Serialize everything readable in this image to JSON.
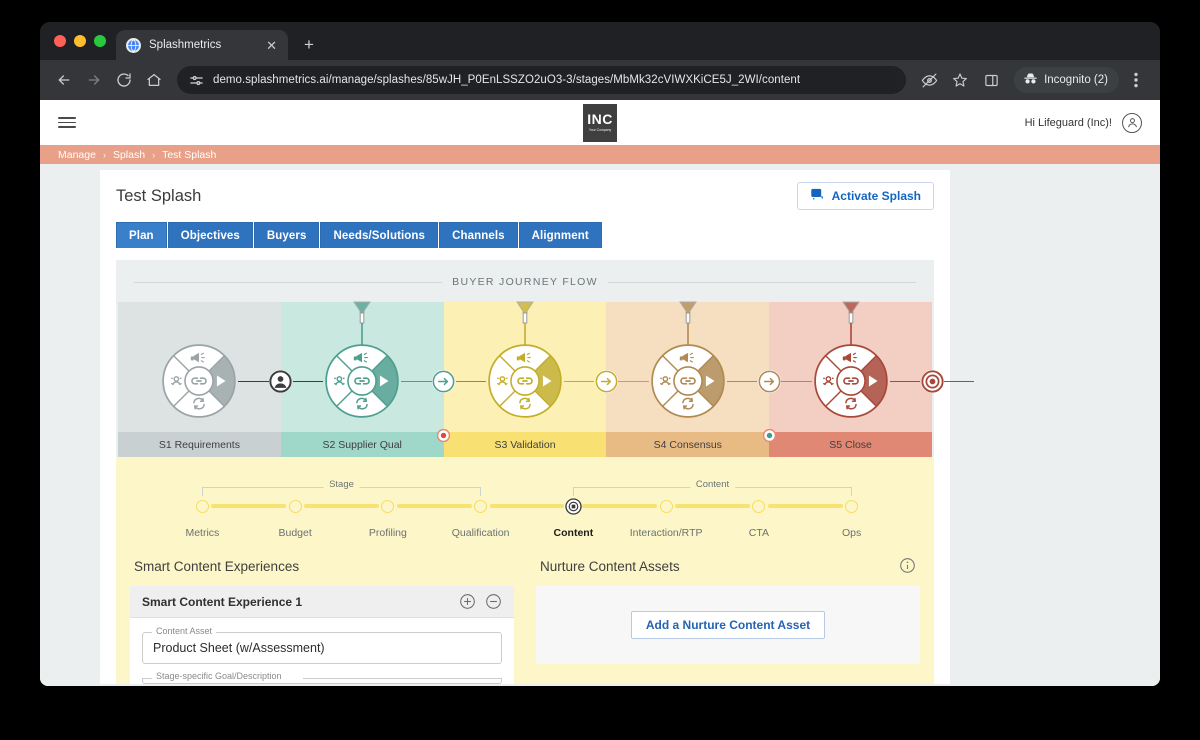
{
  "browser": {
    "tab": {
      "title": "Splashmetrics",
      "favicon_icon": "globe-icon",
      "close_icon": "close-icon"
    },
    "new_tab_label": "+",
    "nav": {
      "back_icon": "back-arrow-icon",
      "forward_icon": "forward-arrow-icon",
      "reload_icon": "reload-icon",
      "home_icon": "home-icon"
    },
    "omnibox": {
      "site_settings_icon": "tune-icon",
      "url": "demo.splashmetrics.ai/manage/splashes/85wJH_P0EnLSSZO2uO3-3/stages/MbMk32cVIWXKiCE5J_2WI/content"
    },
    "actions": {
      "tracking_protection_icon": "eye-slash-icon",
      "bookmark_icon": "star-icon",
      "side_panel_icon": "side-panel-icon",
      "incognito_icon": "incognito-hat-icon",
      "incognito_label": "Incognito (2)",
      "menu_icon": "kebab-menu-icon"
    }
  },
  "app": {
    "menu_icon": "hamburger-menu-icon",
    "logo": {
      "line1": "INC",
      "line2": "Your Company"
    },
    "greeting": "Hi Lifeguard (Inc)!",
    "account_icon": "account-circle-icon",
    "breadcrumb": [
      "Manage",
      "Splash",
      "Test Splash"
    ],
    "breadcrumb_separator": "›",
    "breadcrumb_bar_color": "#e8a088"
  },
  "page": {
    "title": "Test Splash",
    "activate_button": {
      "label": "Activate Splash",
      "icon": "announcement-icon",
      "color": "#1565c0"
    },
    "tabs": [
      {
        "label": "Plan",
        "active": true
      },
      {
        "label": "Objectives",
        "active": false
      },
      {
        "label": "Buyers",
        "active": false
      },
      {
        "label": "Needs/Solutions",
        "active": false
      },
      {
        "label": "Channels",
        "active": false
      },
      {
        "label": "Alignment",
        "active": false
      }
    ],
    "tab_color": "#2f72bd"
  },
  "journey": {
    "heading": "BUYER JOURNEY FLOW",
    "stages": [
      {
        "label": "S1 Requirements",
        "bg": "#dde2e3",
        "label_bg": "#c8d0d1",
        "accent": "#9aa4a6",
        "funnel": false
      },
      {
        "label": "S2 Supplier Qual",
        "bg": "#c9e8e0",
        "label_bg": "#9fd7c8",
        "accent": "#4e9f8f",
        "funnel": true
      },
      {
        "label": "S3 Validation",
        "bg": "#fdf0b5",
        "label_bg": "#f8e072",
        "accent": "#c3ae2c",
        "funnel": true
      },
      {
        "label": "S4 Consensus",
        "bg": "#f6dfc0",
        "label_bg": "#e8bb85",
        "accent": "#b08a52",
        "funnel": true
      },
      {
        "label": "S5 Close",
        "bg": "#f3cec3",
        "label_bg": "#e08873",
        "accent": "#a8483a",
        "funnel": true
      }
    ],
    "wheel_icons": [
      "megaphone-icon",
      "play-icon",
      "refresh-icon",
      "persona-icon",
      "link-icon"
    ],
    "nodes": [
      {
        "type": "persona",
        "icon": "persona-node-icon",
        "color": "#3d3d3d"
      },
      {
        "type": "arrow",
        "icon": "arrow-node-icon",
        "color": "#4e9f8f"
      },
      {
        "type": "arrow",
        "icon": "arrow-node-icon",
        "color": "#c3ae2c"
      },
      {
        "type": "arrow",
        "icon": "arrow-node-icon",
        "color": "#b08a52"
      },
      {
        "type": "target",
        "icon": "target-node-icon",
        "color": "#a8483a"
      }
    ],
    "subnodes": [
      {
        "icon": "content-dot-icon",
        "ring": "#e08873",
        "core": "#d4503c"
      },
      {
        "icon": "content-dot-icon",
        "ring": "#e08873",
        "core": "#3d9e8e"
      }
    ]
  },
  "stepper": {
    "brackets": [
      {
        "label": "Stage",
        "start": 0,
        "end": 3
      },
      {
        "label": "Content",
        "start": 4,
        "end": 7
      }
    ],
    "steps": [
      {
        "label": "Metrics",
        "active": false
      },
      {
        "label": "Budget",
        "active": false
      },
      {
        "label": "Profiling",
        "active": false
      },
      {
        "label": "Qualification",
        "active": false
      },
      {
        "label": "Content",
        "active": true
      },
      {
        "label": "Interaction/RTP",
        "active": false
      },
      {
        "label": "CTA",
        "active": false
      },
      {
        "label": "Ops",
        "active": false
      }
    ],
    "track_color": "#f7e272",
    "panel_bg": "#fdf6c8"
  },
  "left_column": {
    "title": "Smart Content Experiences",
    "experience": {
      "title": "Smart Content Experience 1",
      "add_icon": "plus-circle-icon",
      "remove_icon": "minus-circle-icon",
      "content_asset_label": "Content Asset",
      "content_asset_value": "Product Sheet (w/Assessment)",
      "goal_label": "Stage-specific Goal/Description"
    }
  },
  "right_column": {
    "title": "Nurture Content Assets",
    "info_icon": "info-circle-icon",
    "add_button": {
      "label": "Add a Nurture Content Asset",
      "color": "#2563b5"
    }
  }
}
